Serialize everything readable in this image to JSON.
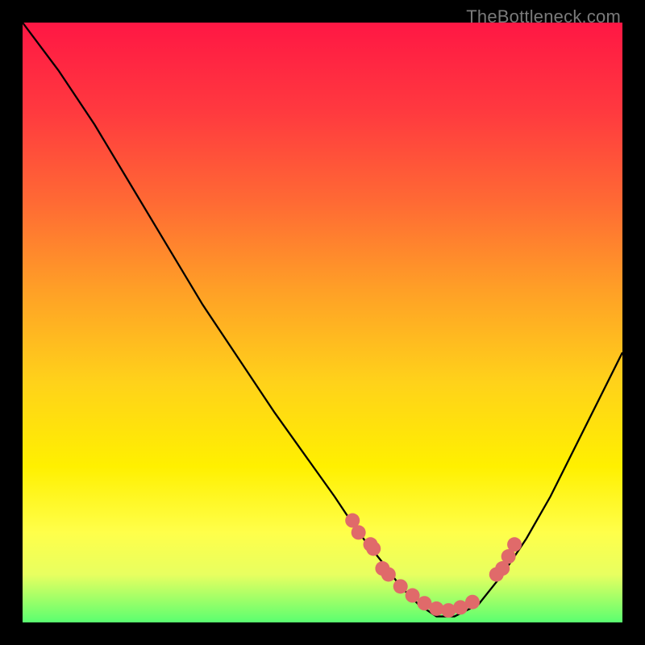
{
  "watermark": "TheBottleneck.com",
  "chart_data": {
    "type": "line",
    "title": "",
    "xlabel": "",
    "ylabel": "",
    "ylim": [
      0,
      100
    ],
    "series": [
      {
        "name": "curve",
        "x": [
          0,
          6,
          12,
          18,
          24,
          30,
          36,
          42,
          47,
          52,
          56,
          60,
          63,
          66,
          69,
          72,
          76,
          80,
          84,
          88,
          92,
          96,
          100
        ],
        "values": [
          100,
          92,
          83,
          73,
          63,
          53,
          44,
          35,
          28,
          21,
          15,
          10,
          6,
          3,
          1,
          1,
          3,
          8,
          14,
          21,
          29,
          37,
          45
        ]
      },
      {
        "name": "markers",
        "x": [
          55,
          56,
          58,
          58.5,
          60,
          61,
          63,
          65,
          67,
          69,
          71,
          73,
          75,
          79,
          80,
          81,
          82
        ],
        "values": [
          17,
          15,
          13,
          12.3,
          9,
          8,
          6,
          4.5,
          3.2,
          2.3,
          2,
          2.5,
          3.4,
          8,
          9,
          11,
          13
        ]
      }
    ],
    "marker_color": "#e06a6a",
    "marker_radius_px": 9
  }
}
